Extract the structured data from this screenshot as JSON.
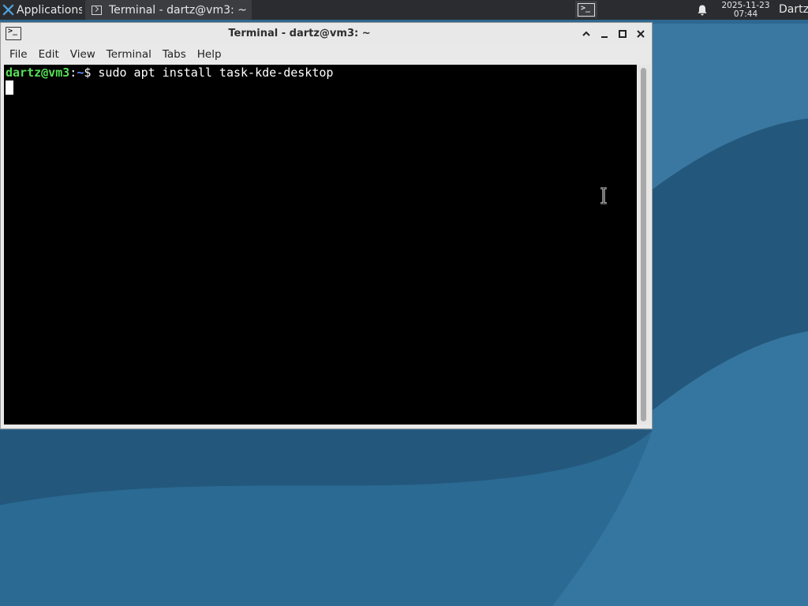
{
  "desktop": {
    "wallpaper_colors": [
      "#2f6a93",
      "#3a7aa4",
      "#24567b"
    ]
  },
  "top_panel": {
    "applications_label": "Applications",
    "applications_overflow_glyph": "☰",
    "task_button_label": "Terminal - dartz@vm3: ~",
    "tray_terminal_icon": "terminal-icon",
    "notification_icon": "bell-icon",
    "clock_date": "2025-11-23",
    "clock_time": "07:44",
    "user_label": "Dartz"
  },
  "terminal_window": {
    "title": "Terminal - dartz@vm3: ~",
    "controls": [
      "shade-up",
      "minimize",
      "maximize",
      "close"
    ],
    "menu": [
      "File",
      "Edit",
      "View",
      "Terminal",
      "Tabs",
      "Help"
    ],
    "prompt": {
      "user_host": "dartz@vm3",
      "separator": ":",
      "path": "~",
      "symbol": "$"
    },
    "command": "sudo apt install task-kde-desktop",
    "colors": {
      "background": "#000000",
      "text": "#ffffff",
      "user_host": "#55e055",
      "path": "#6b8cff"
    }
  }
}
